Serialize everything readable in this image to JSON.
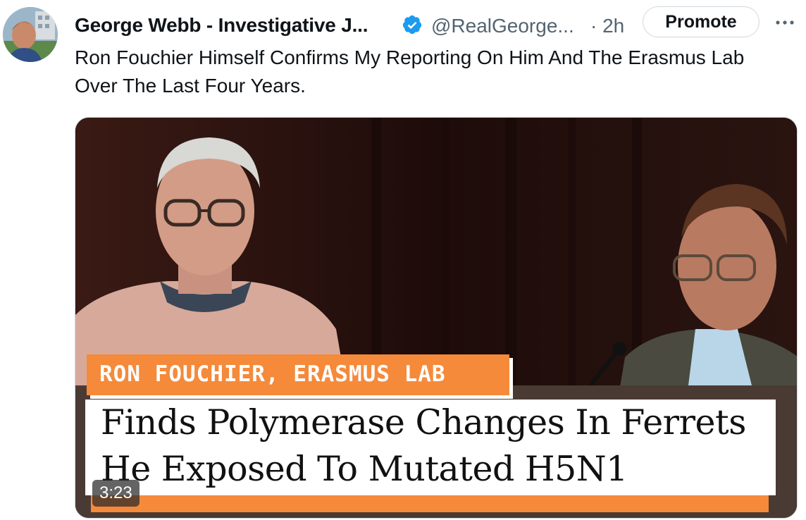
{
  "tweet": {
    "author_name": "George Webb - Investigative J...",
    "handle": "@RealGeorge...",
    "time": "· 2h",
    "promote_label": "Promote",
    "more_icon": "more-horizontal-icon",
    "verified_icon": "verified-badge-icon",
    "text": "Ron Fouchier Himself Confirms My Reporting On Him And The Erasmus Lab Over The Last Four Years."
  },
  "video": {
    "caption_tag": "RON FOUCHIER, ERASMUS LAB",
    "headline_line1": "Finds Polymerase Changes In Ferrets",
    "headline_line2": "He Exposed To Mutated H5N1",
    "duration": "3:23"
  },
  "colors": {
    "accent_blue": "#1d9bf0",
    "secondary_text": "#536471",
    "caption_orange": "#f58a3a",
    "border": "#cfd9de"
  }
}
